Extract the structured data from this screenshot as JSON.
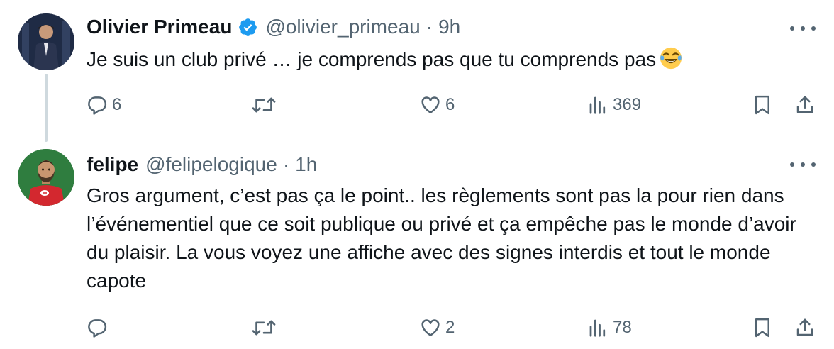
{
  "tweets": [
    {
      "display_name": "Olivier Primeau",
      "verified": true,
      "handle": "@olivier_primeau",
      "separator": "·",
      "time": "9h",
      "text": "Je suis un club privé … je comprends pas que tu comprends pas",
      "emoji": "face-with-tears-of-joy",
      "replies": "6",
      "retweets": "",
      "likes": "6",
      "views": "369"
    },
    {
      "display_name": "felipe",
      "verified": false,
      "handle": "@felipelogique",
      "separator": "·",
      "time": "1h",
      "text": "Gros argument, c’est pas ça le point.. les règlements sont pas la pour rien dans l’événementiel que ce soit publique ou privé et ça empêche pas le monde d’avoir du plaisir. La vous voyez une affiche avec des signes interdis et tout le monde capote",
      "replies": "",
      "retweets": "",
      "likes": "2",
      "views": "78"
    }
  ],
  "colors": {
    "text": "#0f1419",
    "secondary": "#536471",
    "verified_badge": "#1d9bf0",
    "thread_line": "#cfd9de"
  },
  "icons": [
    "reply-icon",
    "retweet-icon",
    "like-icon",
    "views-icon",
    "bookmark-icon",
    "share-icon",
    "more-icon",
    "verified-badge-icon"
  ]
}
